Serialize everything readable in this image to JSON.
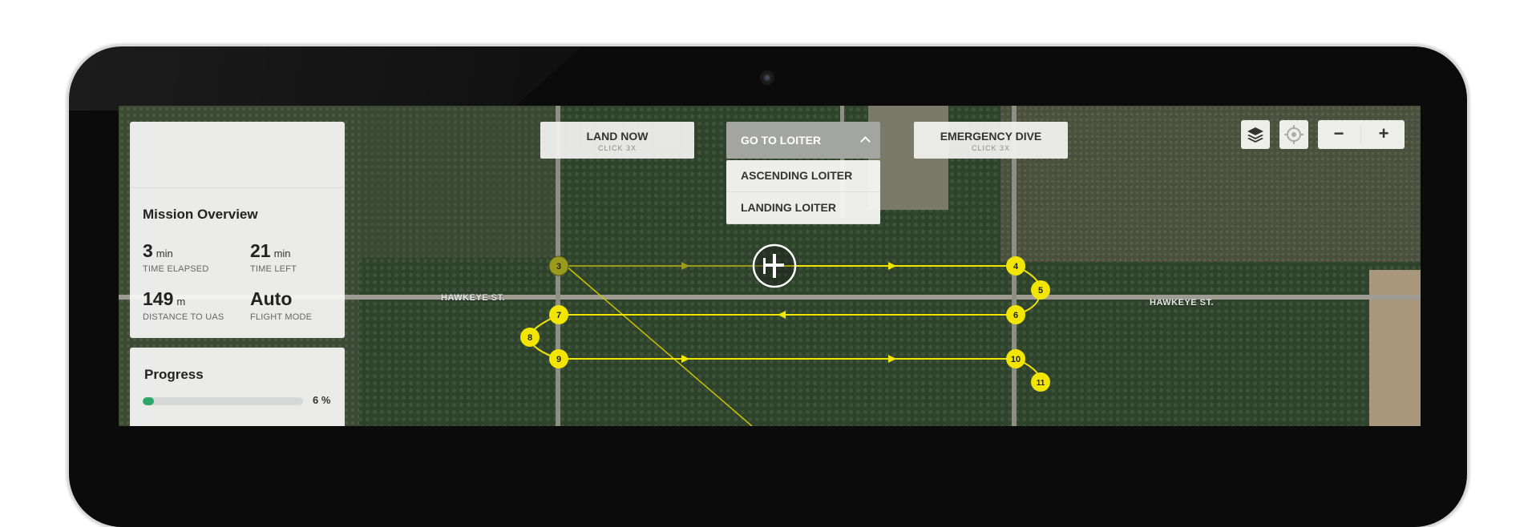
{
  "buttons": {
    "land_now": "LAND NOW",
    "land_now_hint": "CLICK 3X",
    "go_to_loiter": "GO TO LOITER",
    "emergency_dive": "EMERGENCY DIVE",
    "emergency_dive_hint": "CLICK 3X"
  },
  "loiter_menu": {
    "items": [
      "ASCENDING LOITER",
      "LANDING LOITER"
    ]
  },
  "map_controls": {
    "zoom_out": "−",
    "zoom_in": "+",
    "layers_icon": "layers-icon",
    "locate_icon": "crosshair-icon"
  },
  "mission": {
    "title": "Mission Overview",
    "time_elapsed": {
      "value": "3",
      "unit": "min",
      "label": "TIME ELAPSED"
    },
    "time_left": {
      "value": "21",
      "unit": "min",
      "label": "TIME LEFT"
    },
    "distance": {
      "value": "149",
      "unit": "m",
      "label": "DISTANCE TO UAS"
    },
    "flight_mode": {
      "value": "Auto",
      "label": "FLIGHT MODE"
    }
  },
  "progress": {
    "title": "Progress",
    "percent_label": "6 %",
    "fraction": 0.06
  },
  "map": {
    "road_labels": [
      "HAWKEYE ST.",
      "HAWKEYE ST."
    ],
    "waypoints": [
      "3",
      "4",
      "5",
      "6",
      "7",
      "8",
      "9",
      "10",
      "11"
    ]
  },
  "colors": {
    "route": "#f2e500",
    "route_done": "#9a9a1e",
    "progress_fill": "#2ea86a",
    "loiter_active": "#a3a5a1"
  }
}
